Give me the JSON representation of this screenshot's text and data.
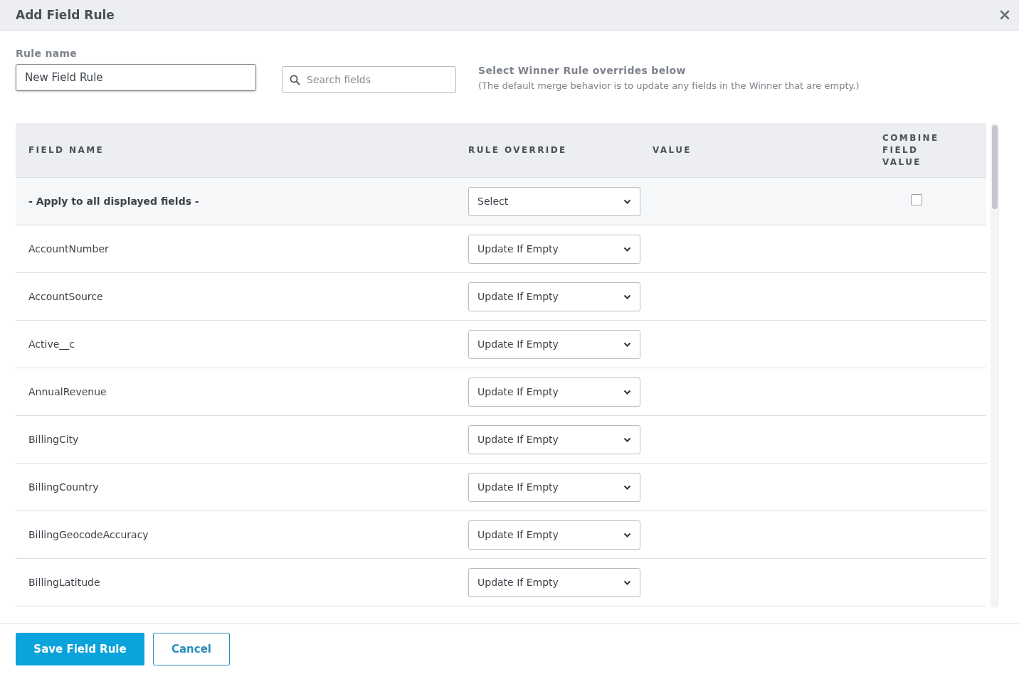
{
  "dialog": {
    "title": "Add Field Rule"
  },
  "rule_name": {
    "label": "Rule name",
    "value": "New Field Rule"
  },
  "search": {
    "placeholder": "Search fields"
  },
  "note": {
    "heading": "Select Winner Rule overrides below",
    "text": "(The default merge behavior is to update any fields in the Winner that are empty.)"
  },
  "table": {
    "columns": [
      "FIELD NAME",
      "RULE OVERRIDE",
      "VALUE",
      "COMBINE FIELD VALUE"
    ],
    "rows": [
      {
        "kind": "apply_all",
        "field": "- Apply to all displayed fields -",
        "rule": "Select",
        "checked": false
      },
      {
        "kind": "field",
        "field": "AccountNumber",
        "rule": "Update If Empty"
      },
      {
        "kind": "field",
        "field": "AccountSource",
        "rule": "Update If Empty"
      },
      {
        "kind": "field",
        "field": "Active__c",
        "rule": "Update If Empty"
      },
      {
        "kind": "field",
        "field": "AnnualRevenue",
        "rule": "Update If Empty"
      },
      {
        "kind": "field",
        "field": "BillingCity",
        "rule": "Update If Empty"
      },
      {
        "kind": "field",
        "field": "BillingCountry",
        "rule": "Update If Empty"
      },
      {
        "kind": "field",
        "field": "BillingGeocodeAccuracy",
        "rule": "Update If Empty"
      },
      {
        "kind": "field",
        "field": "BillingLatitude",
        "rule": "Update If Empty"
      }
    ]
  },
  "buttons": [
    {
      "kind": "primary",
      "label": "Save Field Rule"
    },
    {
      "kind": "secondary",
      "label": "Cancel"
    }
  ]
}
